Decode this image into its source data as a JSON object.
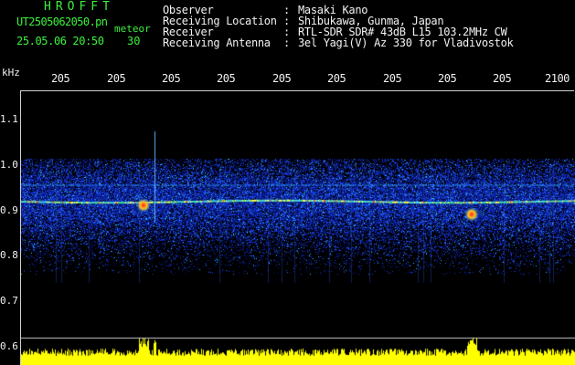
{
  "header": {
    "title": "HROFFT",
    "filename": "UT2505062050.pn",
    "mode": "meteor",
    "date_time": "25.05.06 20:50",
    "seconds": "30"
  },
  "info": {
    "observer_label": "Observer",
    "observer_value": "Masaki Kano",
    "location_label": "Receiving Location",
    "location_value": "Shibukawa, Gunma, Japan",
    "receiver_label": "Receiver",
    "receiver_value": "RTL-SDR SDR# 43dB L15 103.2MHz CW",
    "antenna_label": "Receiving Antenna",
    "antenna_value": "3el Yagi(V) Az 330 for Vladivostok",
    "colon": ":"
  },
  "axis": {
    "y_unit": "kHz",
    "y_ticks": [
      "1.1",
      "1.0",
      "0.9",
      "0.8",
      "0.7",
      "0.6"
    ],
    "x_ticks": [
      "205",
      "205",
      "205",
      "205",
      "205",
      "205",
      "205",
      "205",
      "205",
      "2100"
    ]
  },
  "spectrogram": {
    "band_center_khz": 0.92,
    "band_upper_khz": 0.955,
    "noise_top_khz": 1.0,
    "noise_bottom_khz": 0.78,
    "meteor_echo_1_khz": 0.91,
    "meteor_echo_2_khz": 0.89
  },
  "colors": {
    "background": "#000000",
    "header_green": "#3cf23c",
    "text_white": "#f2f2f2",
    "noise_blue": "#1030d0",
    "signal_cyan": "#40d0ff",
    "echo_red": "#ff2020",
    "level_yellow": "#ffff00"
  }
}
